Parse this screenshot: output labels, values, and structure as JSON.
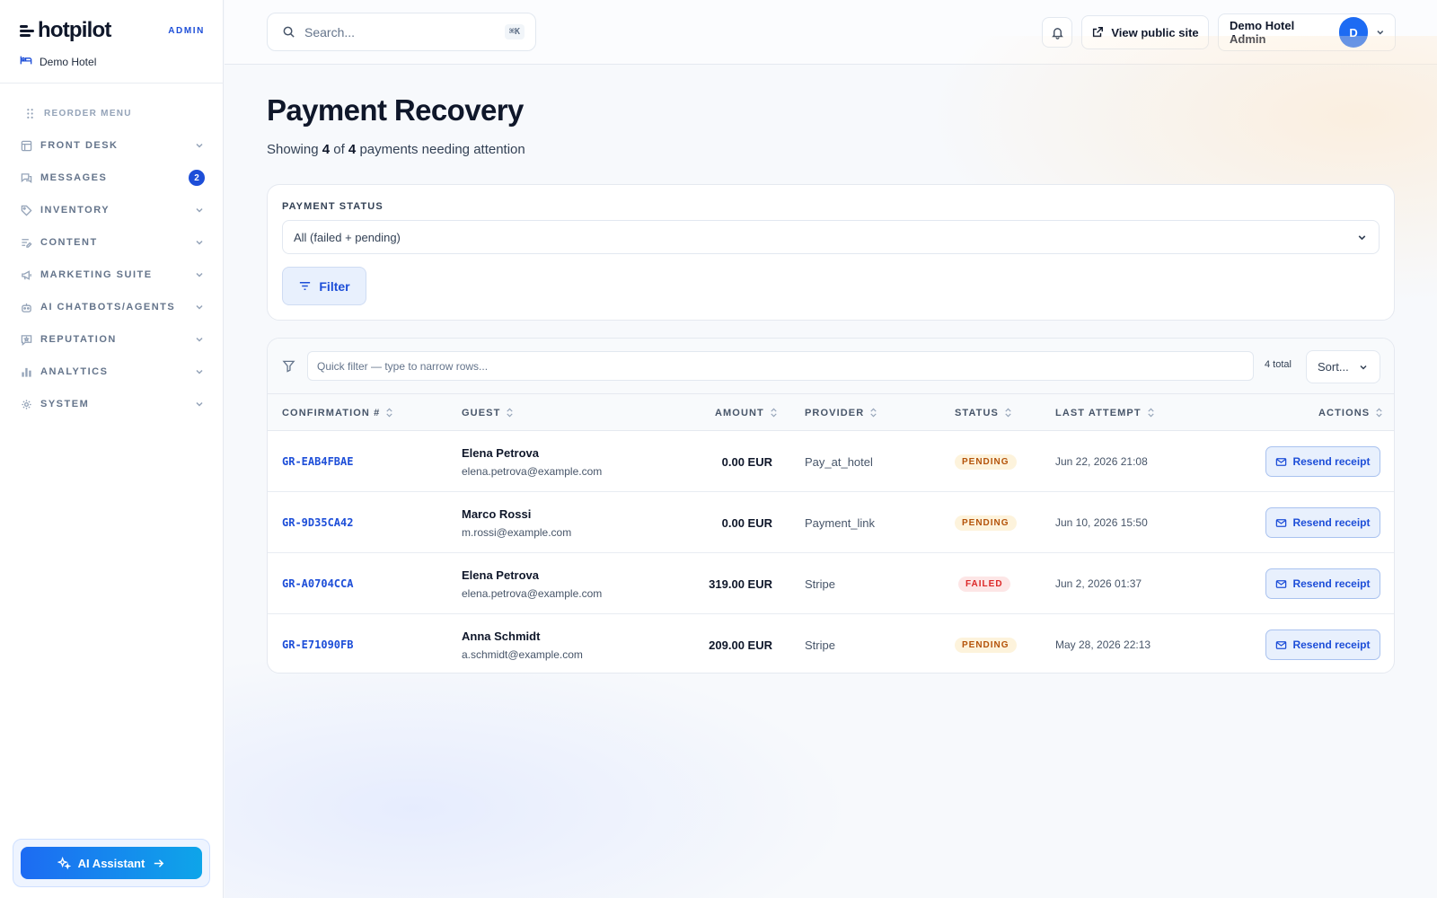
{
  "brand": {
    "name": "hotpilot",
    "tag": "ADMIN",
    "hotel": "Demo Hotel"
  },
  "sidebar": {
    "reorder_label": "REORDER MENU",
    "items": [
      {
        "label": "FRONT DESK",
        "icon": "layout-icon"
      },
      {
        "label": "MESSAGES",
        "icon": "chat-icon",
        "badge": "2"
      },
      {
        "label": "INVENTORY",
        "icon": "tag-icon"
      },
      {
        "label": "CONTENT",
        "icon": "content-icon"
      },
      {
        "label": "MARKETING SUITE",
        "icon": "megaphone-icon"
      },
      {
        "label": "AI CHATBOTS/AGENTS",
        "icon": "bot-icon"
      },
      {
        "label": "REPUTATION",
        "icon": "review-icon"
      },
      {
        "label": "ANALYTICS",
        "icon": "bar-chart-icon"
      },
      {
        "label": "SYSTEM",
        "icon": "gear-icon"
      }
    ],
    "ai_assistant_label": "AI Assistant"
  },
  "header": {
    "search_placeholder": "Search...",
    "search_shortcut": "⌘K",
    "public_site_label": "View public site",
    "user_name": "Demo Hotel Admin",
    "user_initial": "D"
  },
  "page": {
    "title": "Payment Recovery",
    "subtitle_prefix": "Showing",
    "shown_count": "4",
    "subtitle_of": "of",
    "total_count": "4",
    "subtitle_suffix": "payments needing attention"
  },
  "filter": {
    "status_label": "PAYMENT STATUS",
    "status_value": "All (failed + pending)",
    "button_label": "Filter"
  },
  "table": {
    "quick_filter_placeholder": "Quick filter — type to narrow rows...",
    "total_label": "4 total",
    "sort_label": "Sort...",
    "columns": {
      "confirmation": "CONFIRMATION #",
      "guest": "GUEST",
      "amount": "AMOUNT",
      "provider": "PROVIDER",
      "status": "STATUS",
      "last_attempt": "LAST ATTEMPT",
      "actions": "ACTIONS"
    },
    "rows": [
      {
        "confirmation": "GR-EAB4FBAE",
        "guest_name": "Elena Petrova",
        "guest_email": "elena.petrova@example.com",
        "amount": "0.00 EUR",
        "provider": "Pay_at_hotel",
        "status": "PENDING",
        "status_kind": "pending",
        "last_attempt": "Jun 22, 2026 21:08",
        "action": "Resend receipt"
      },
      {
        "confirmation": "GR-9D35CA42",
        "guest_name": "Marco Rossi",
        "guest_email": "m.rossi@example.com",
        "amount": "0.00 EUR",
        "provider": "Payment_link",
        "status": "PENDING",
        "status_kind": "pending",
        "last_attempt": "Jun 10, 2026 15:50",
        "action": "Resend receipt"
      },
      {
        "confirmation": "GR-A0704CCA",
        "guest_name": "Elena Petrova",
        "guest_email": "elena.petrova@example.com",
        "amount": "319.00 EUR",
        "provider": "Stripe",
        "status": "FAILED",
        "status_kind": "failed",
        "last_attempt": "Jun 2, 2026 01:37",
        "action": "Resend receipt"
      },
      {
        "confirmation": "GR-E71090FB",
        "guest_name": "Anna Schmidt",
        "guest_email": "a.schmidt@example.com",
        "amount": "209.00 EUR",
        "provider": "Stripe",
        "status": "PENDING",
        "status_kind": "pending",
        "last_attempt": "May 28, 2026 22:13",
        "action": "Resend receipt"
      }
    ]
  },
  "colors": {
    "accent": "#1d4ed8",
    "pending": "#b45309",
    "failed": "#dc2626"
  }
}
